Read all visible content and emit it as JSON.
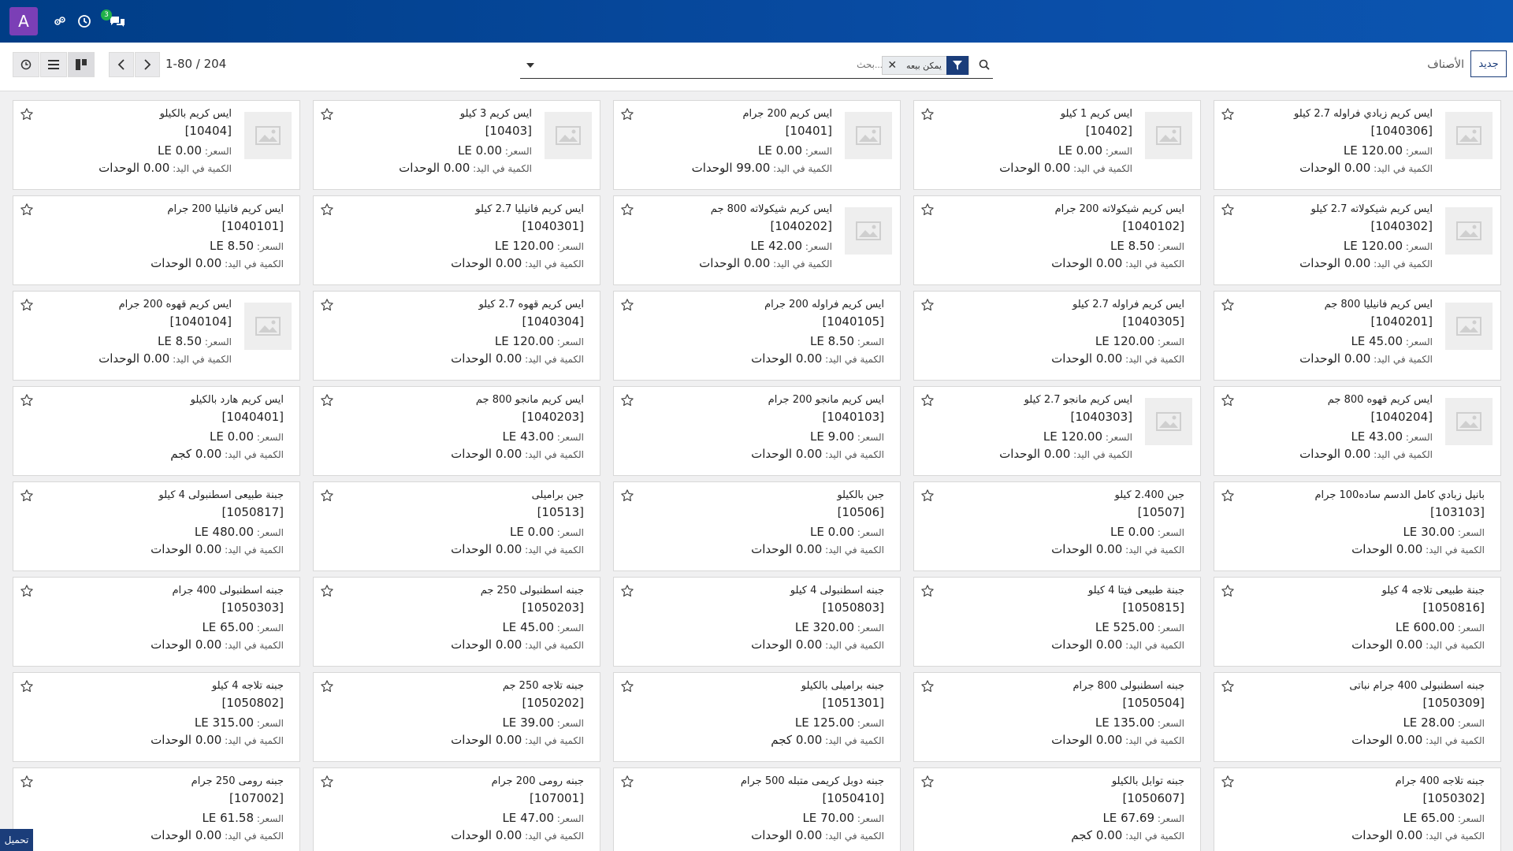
{
  "navbar": {
    "app_letter": "A",
    "chat_badge": "3"
  },
  "control": {
    "pager": "1-80 / 204",
    "search_placeholder": "بحث...",
    "facet_label": "يمكن بيعه",
    "breadcrumb": "الأصناف",
    "new_button": "جديد"
  },
  "labels": {
    "price": "السعر: ",
    "qty": "الكمية في اليد: "
  },
  "upload_button": "تحميل",
  "products": [
    {
      "name": "ايس كريم زبادي فراوله 2.7 كيلو",
      "code": "[1040306]",
      "price": "120.00 LE",
      "qty": "0.00 الوحدات",
      "image": true
    },
    {
      "name": "ايس كريم 1 كيلو",
      "code": "[10402]",
      "price": "0.00 LE",
      "qty": "0.00 الوحدات",
      "image": true
    },
    {
      "name": "ايس كريم 200 جرام",
      "code": "[10401]",
      "price": "0.00 LE",
      "qty": "99.00 الوحدات",
      "image": true
    },
    {
      "name": "ايس كريم 3 كيلو",
      "code": "[10403]",
      "price": "0.00 LE",
      "qty": "0.00 الوحدات",
      "image": true
    },
    {
      "name": "ايس كريم بالكيلو",
      "code": "[10404]",
      "price": "0.00 LE",
      "qty": "0.00 الوحدات",
      "image": true
    },
    {
      "name": "ايس كريم شيكولاته 2.7 كيلو",
      "code": "[1040302]",
      "price": "120.00 LE",
      "qty": "0.00 الوحدات",
      "image": true
    },
    {
      "name": "ايس كريم شيكولاته 200 جرام",
      "code": "[1040102]",
      "price": "8.50 LE",
      "qty": "0.00 الوحدات",
      "image": false
    },
    {
      "name": "ايس كريم شيكولاته 800 جم",
      "code": "[1040202]",
      "price": "42.00 LE",
      "qty": "0.00 الوحدات",
      "image": true
    },
    {
      "name": "ايس كريم فانيليا 2.7 كيلو",
      "code": "[1040301]",
      "price": "120.00 LE",
      "qty": "0.00 الوحدات",
      "image": false
    },
    {
      "name": "ايس كريم فانيليا 200 جرام",
      "code": "[1040101]",
      "price": "8.50 LE",
      "qty": "0.00 الوحدات",
      "image": false
    },
    {
      "name": "ايس كريم فانيليا 800 جم",
      "code": "[1040201]",
      "price": "45.00 LE",
      "qty": "0.00 الوحدات",
      "image": true
    },
    {
      "name": "ايس كريم فراوله 2.7 كيلو",
      "code": "[1040305]",
      "price": "120.00 LE",
      "qty": "0.00 الوحدات",
      "image": false
    },
    {
      "name": "ايس كريم فراوله 200 جرام",
      "code": "[1040105]",
      "price": "8.50 LE",
      "qty": "0.00 الوحدات",
      "image": false
    },
    {
      "name": "ايس كريم قهوه 2.7 كيلو",
      "code": "[1040304]",
      "price": "120.00 LE",
      "qty": "0.00 الوحدات",
      "image": false
    },
    {
      "name": "ايس كريم قهوه 200 جرام",
      "code": "[1040104]",
      "price": "8.50 LE",
      "qty": "0.00 الوحدات",
      "image": true
    },
    {
      "name": "ايس كريم قهوه 800 جم",
      "code": "[1040204]",
      "price": "43.00 LE",
      "qty": "0.00 الوحدات",
      "image": true
    },
    {
      "name": "ايس كريم مانجو 2.7 كيلو",
      "code": "[1040303]",
      "price": "120.00 LE",
      "qty": "0.00 الوحدات",
      "image": true
    },
    {
      "name": "ايس كريم مانجو 200 جرام",
      "code": "[1040103]",
      "price": "9.00 LE",
      "qty": "0.00 الوحدات",
      "image": false
    },
    {
      "name": "ايس كريم مانجو 800 جم",
      "code": "[1040203]",
      "price": "43.00 LE",
      "qty": "0.00 الوحدات",
      "image": false
    },
    {
      "name": "ايس كريم هارد بالكيلو",
      "code": "[1040401]",
      "price": "0.00 LE",
      "qty": "0.00 كجم",
      "image": false
    },
    {
      "name": "بانيل زبادي كامل الدسم ساده100 جرام",
      "code": "[103103]",
      "price": "30.00 LE",
      "qty": "0.00 الوحدات",
      "image": false
    },
    {
      "name": "جبن 2.400 كيلو",
      "code": "[10507]",
      "price": "0.00 LE",
      "qty": "0.00 الوحدات",
      "image": false
    },
    {
      "name": "جبن بالكيلو",
      "code": "[10506]",
      "price": "0.00 LE",
      "qty": "0.00 الوحدات",
      "image": false
    },
    {
      "name": "جبن براميلى",
      "code": "[10513]",
      "price": "0.00 LE",
      "qty": "0.00 الوحدات",
      "image": false
    },
    {
      "name": "جبنة طبيعى اسطنبولى 4 كيلو",
      "code": "[1050817]",
      "price": "480.00 LE",
      "qty": "0.00 الوحدات",
      "image": false
    },
    {
      "name": "جبنة طبيعى تلاجه 4 كيلو",
      "code": "[1050816]",
      "price": "600.00 LE",
      "qty": "0.00 الوحدات",
      "image": false
    },
    {
      "name": "جبنة طبيعى فيتا 4 كيلو",
      "code": "[1050815]",
      "price": "525.00 LE",
      "qty": "0.00 الوحدات",
      "image": false
    },
    {
      "name": "جبنه اسطنبولى 4 كيلو",
      "code": "[1050803]",
      "price": "320.00 LE",
      "qty": "0.00 الوحدات",
      "image": false
    },
    {
      "name": "جبنه اسطنبولى 250 جم",
      "code": "[1050203]",
      "price": "45.00 LE",
      "qty": "0.00 الوحدات",
      "image": false
    },
    {
      "name": "جبنه اسطنبولى 400 جرام",
      "code": "[1050303]",
      "price": "65.00 LE",
      "qty": "0.00 الوحدات",
      "image": false
    },
    {
      "name": "جبنه اسطنبولى 400 جرام نباتى",
      "code": "[1050309]",
      "price": "28.00 LE",
      "qty": "0.00 الوحدات",
      "image": false
    },
    {
      "name": "جبنه اسطنبولى 800 جرام",
      "code": "[1050504]",
      "price": "135.00 LE",
      "qty": "0.00 الوحدات",
      "image": false
    },
    {
      "name": "جبنه براميلى بالكيلو",
      "code": "[1051301]",
      "price": "125.00 LE",
      "qty": "0.00 كجم",
      "image": false
    },
    {
      "name": "جبنه تلاجه 250 جم",
      "code": "[1050202]",
      "price": "39.00 LE",
      "qty": "0.00 الوحدات",
      "image": false
    },
    {
      "name": "جبنه تلاجه 4 كيلو",
      "code": "[1050802]",
      "price": "315.00 LE",
      "qty": "0.00 الوحدات",
      "image": false
    },
    {
      "name": "جبنه تلاجه 400 جرام",
      "code": "[1050302]",
      "price": "65.00 LE",
      "qty": "0.00 الوحدات",
      "image": false
    },
    {
      "name": "جبنه توابل بالكيلو",
      "code": "[1050607]",
      "price": "67.69 LE",
      "qty": "0.00 كجم",
      "image": false
    },
    {
      "name": "جبنه دوبل كريمى متبله 500 جرام",
      "code": "[1050410]",
      "price": "70.00 LE",
      "qty": "0.00 الوحدات",
      "image": false
    },
    {
      "name": "جبنه رومى 200 جرام",
      "code": "[107001]",
      "price": "47.00 LE",
      "qty": "0.00 الوحدات",
      "image": false
    },
    {
      "name": "جبنه رومى 250 جرام",
      "code": "[107002]",
      "price": "61.58 LE",
      "qty": "0.00 الوحدات",
      "image": false
    }
  ]
}
